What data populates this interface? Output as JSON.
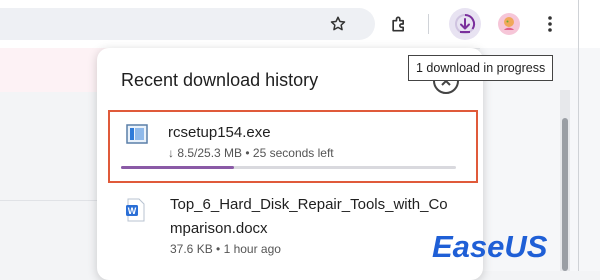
{
  "panel": {
    "title": "Recent download history",
    "items": [
      {
        "name": "rcsetup154.exe",
        "status": "↓ 8.5/25.3 MB • 25 seconds left",
        "progress": 0.336,
        "icon": "exe-file-icon"
      },
      {
        "name_line1": "Top_6_Hard_Disk_Repair_Tools_with_Co",
        "name_line2": "mparison.docx",
        "status": "37.6 KB • 1 hour ago",
        "icon": "word-doc-icon"
      }
    ]
  },
  "tooltip": {
    "text": "1 download in progress"
  },
  "watermark": {
    "text": "EaseUS"
  },
  "colors": {
    "highlight_border": "#e05a3a",
    "progress": "#8a5aa6",
    "download_button_bg": "#e8e3f2",
    "watermark": "#1f5fd6"
  }
}
